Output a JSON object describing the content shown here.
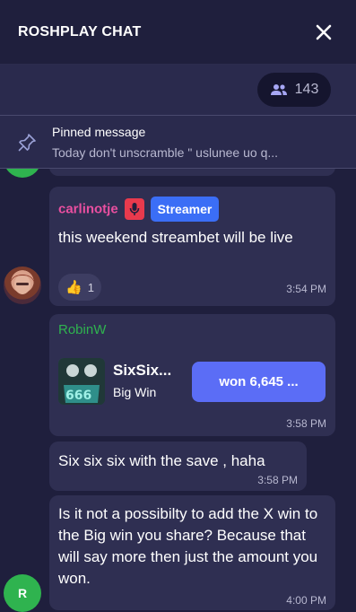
{
  "header": {
    "title": "ROSHPLAY CHAT"
  },
  "online": {
    "count": "143"
  },
  "pinned": {
    "title": "Pinned message",
    "text": "Today don't unscramble \" uslunee uo q..."
  },
  "messages": [
    {
      "username": "carlinotje",
      "username_color": "#e94fa0",
      "badge": "Streamer",
      "text": "this weekend streambet will be live",
      "reaction_emoji": "👍",
      "reaction_count": "1",
      "time": "3:54 PM"
    },
    {
      "username": "RobinW",
      "username_color": "#2fb34f",
      "game_title": "SixSix...",
      "game_subtitle": "Big Win",
      "won_label": "won 6,645 ...",
      "time": "3:58 PM"
    },
    {
      "text": "Six six six with the save , haha",
      "time": "3:58 PM"
    },
    {
      "text": "Is it not a possibilty to add the X win to the Big win you share? Because that will say more then just the amount you won.",
      "time": "4:00 PM",
      "avatar_letter": "R"
    }
  ],
  "colors": {
    "background": "#1f1f3d",
    "bubble": "#2f2f52",
    "accent_blue": "#3b6ef6",
    "won_button": "#5b6df6",
    "mic_badge": "#e83a4d",
    "avatar_green": "#2fb34f"
  }
}
